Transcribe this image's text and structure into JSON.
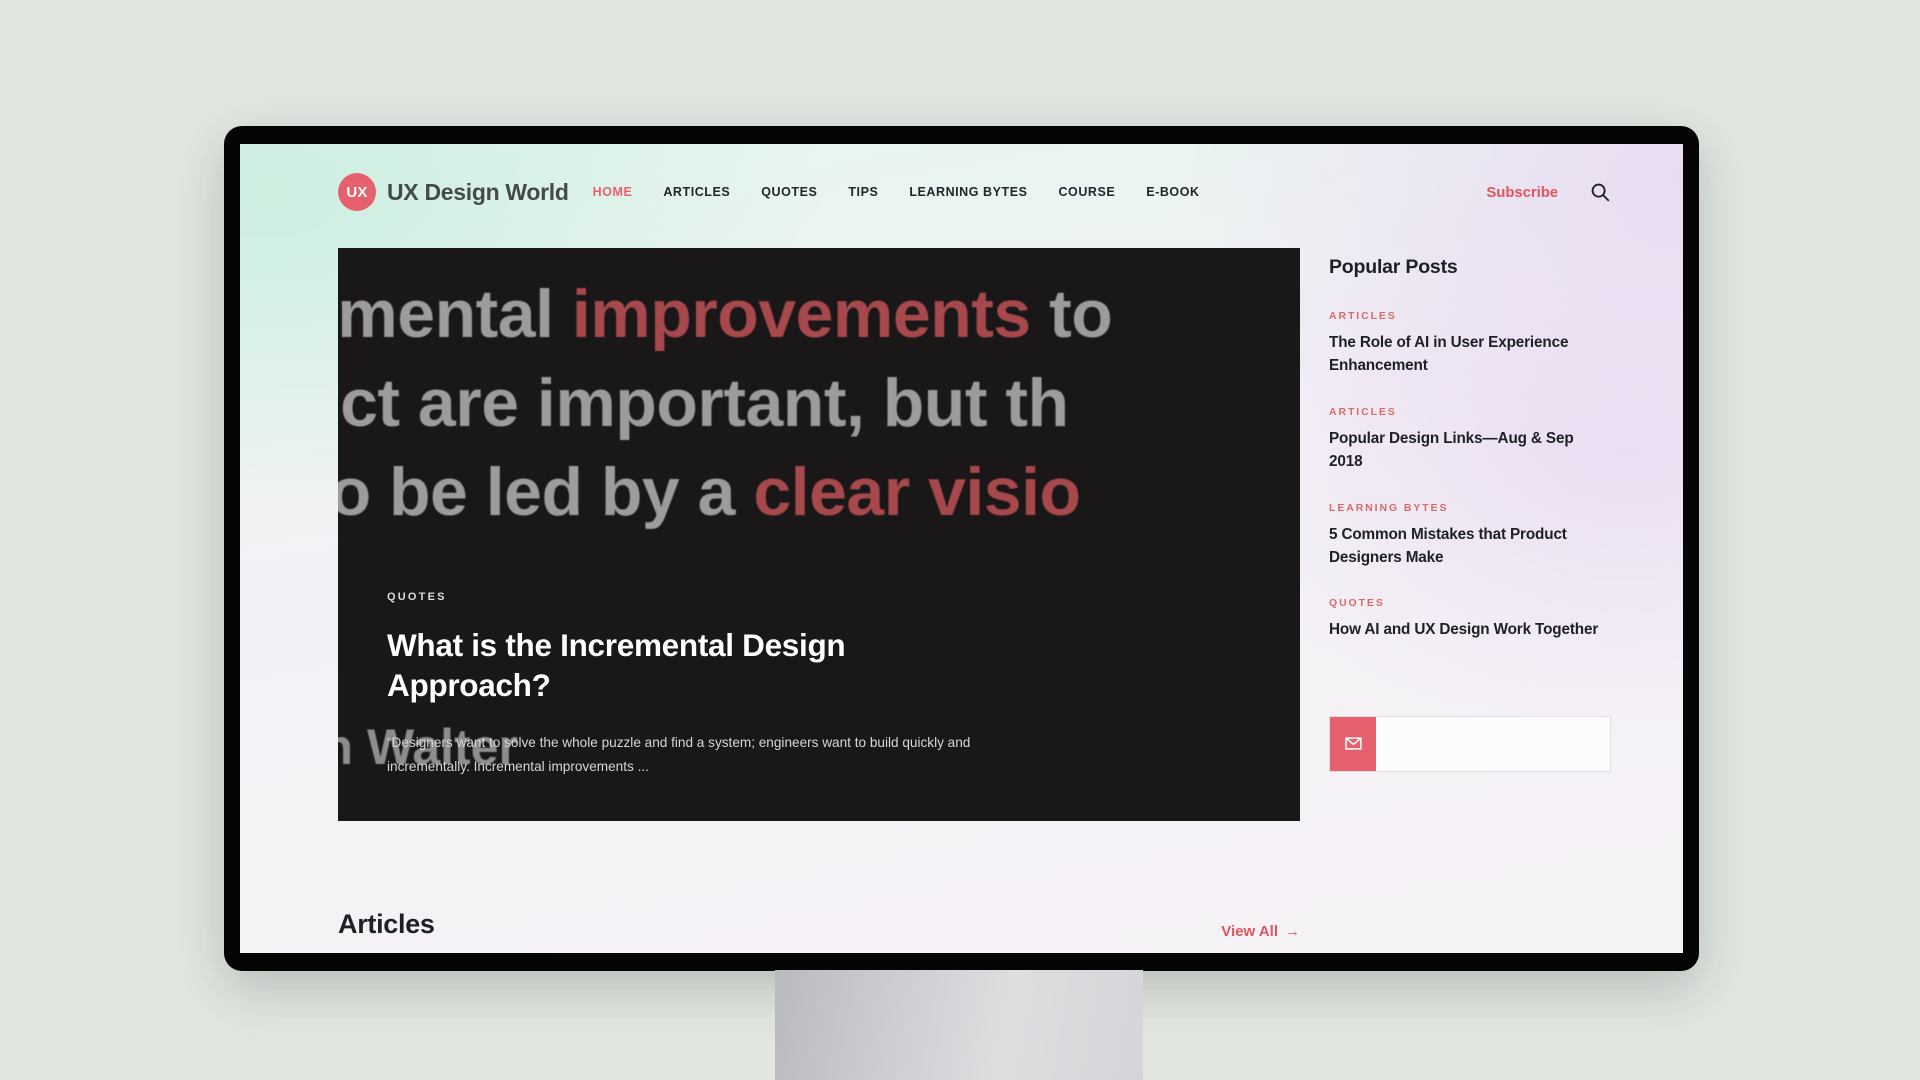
{
  "site": {
    "logo_badge": "UX",
    "name": "UX Design World"
  },
  "nav": {
    "links": [
      {
        "label": "HOME",
        "active": true
      },
      {
        "label": "ARTICLES",
        "active": false
      },
      {
        "label": "QUOTES",
        "active": false
      },
      {
        "label": "TIPS",
        "active": false
      },
      {
        "label": "LEARNING BYTES",
        "active": false
      },
      {
        "label": "COURSE",
        "active": false
      },
      {
        "label": "E-BOOK",
        "active": false
      }
    ],
    "subscribe_label": "Subscribe",
    "search_icon": "search-icon"
  },
  "hero": {
    "background_text_line1_a": "remental ",
    "background_text_line1_b": "improvements",
    "background_text_line1_c": " to",
    "background_text_line2": "duct are important, but th",
    "background_text_line3_a": "d to be led by a ",
    "background_text_line3_b": "clear visio",
    "attribution": "on Walter",
    "category": "QUOTES",
    "title": "What is the Incremental Design Approach?",
    "excerpt": "“Designers want to solve the whole puzzle and find a system; engineers want to build quickly and incrementally. Incremental improvements ..."
  },
  "section": {
    "title": "Articles",
    "view_all_label": "View All",
    "view_all_arrow": "→"
  },
  "sidebar": {
    "title": "Popular Posts",
    "posts": [
      {
        "category": "ARTICLES",
        "headline": "The Role of AI in User Experience Enhancement"
      },
      {
        "category": "ARTICLES",
        "headline": "Popular Design Links—Aug & Sep 2018"
      },
      {
        "category": "LEARNING BYTES",
        "headline": "5 Common Mistakes that Product Designers Make"
      },
      {
        "category": "QUOTES",
        "headline": "How AI and UX Design Work Together"
      }
    ]
  },
  "subscribe_widget": {
    "icon": "envelope-icon",
    "placeholder": ""
  },
  "colors": {
    "accent": "#e4616d",
    "accent_link": "#e0555f",
    "category_red": "#d96a6a",
    "ink": "#1d2024",
    "hero_bg": "#191718",
    "page_backdrop": "#e1e6e1",
    "bezel": "#050505"
  }
}
